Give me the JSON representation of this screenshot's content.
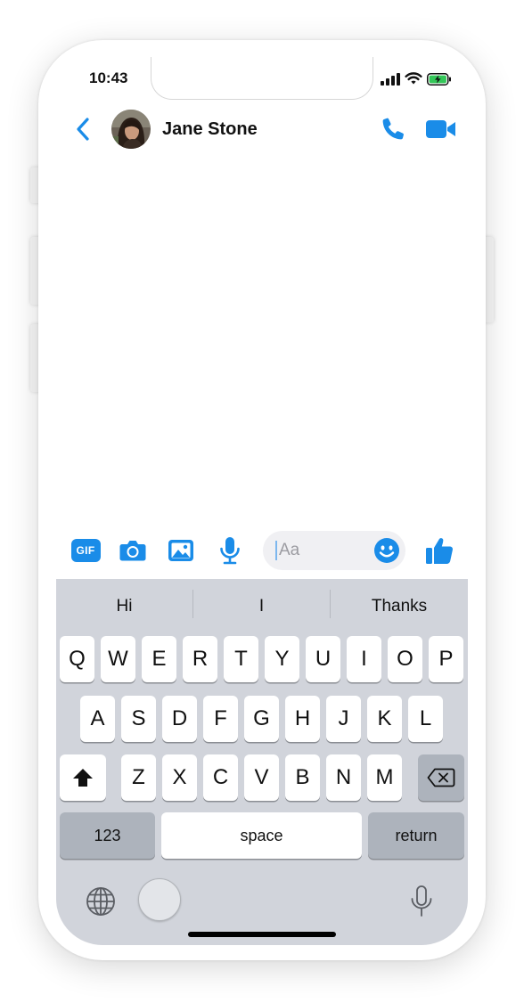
{
  "status": {
    "time": "10:43"
  },
  "header": {
    "contact_name": "Jane Stone",
    "icons": {
      "back": "chevron-left-icon",
      "call": "phone-icon",
      "video": "video-camera-icon"
    }
  },
  "composer": {
    "gif_label": "GIF",
    "input_placeholder": "Aa",
    "icons": [
      "gif-icon",
      "camera-icon",
      "image-icon",
      "microphone-icon",
      "emoji-icon",
      "thumbs-up-icon"
    ]
  },
  "keyboard": {
    "suggestions": [
      "Hi",
      "I",
      "Thanks"
    ],
    "row1": [
      "Q",
      "W",
      "E",
      "R",
      "T",
      "Y",
      "U",
      "I",
      "O",
      "P"
    ],
    "row2": [
      "A",
      "S",
      "D",
      "F",
      "G",
      "H",
      "J",
      "K",
      "L"
    ],
    "row3": [
      "Z",
      "X",
      "C",
      "V",
      "B",
      "N",
      "M"
    ],
    "numbers_label": "123",
    "space_label": "space",
    "return_label": "return"
  },
  "colors": {
    "accent": "#1a8ce8",
    "keyboard_bg": "#d1d4db",
    "key_dark": "#adb3bc"
  }
}
